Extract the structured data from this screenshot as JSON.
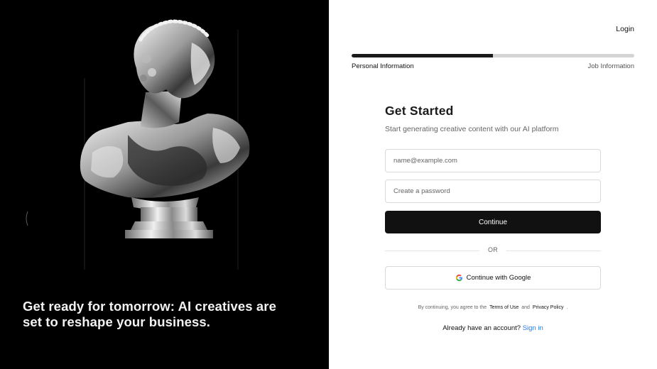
{
  "hero": {
    "headline": "Get ready for tomorrow: AI creatives are set to reshape your business."
  },
  "header": {
    "login_label": "Login"
  },
  "progress": {
    "value_fraction": 0.5,
    "step1_label": "Personal Information",
    "step2_label": "Job Information"
  },
  "form": {
    "title": "Get Started",
    "subtitle": "Start generating creative content with our AI platform",
    "email_placeholder": "name@example.com",
    "password_placeholder": "Create a password",
    "continue_label": "Continue",
    "divider_label": "OR",
    "google_label": "Continue with Google",
    "google_icon": "google-icon"
  },
  "legal": {
    "prefix": "By continuing, you agree to the",
    "terms_label": "Terms of Use",
    "and": "and",
    "privacy_label": "Privacy Policy",
    "suffix": "."
  },
  "signin": {
    "prompt": "Already have an account?",
    "link_label": "Sign in"
  },
  "colors": {
    "left_bg": "#000000",
    "primary_button": "#111111",
    "link_blue": "#2f7de1",
    "progress_track": "#d4d4d4",
    "progress_fill": "#1a1a1a"
  }
}
